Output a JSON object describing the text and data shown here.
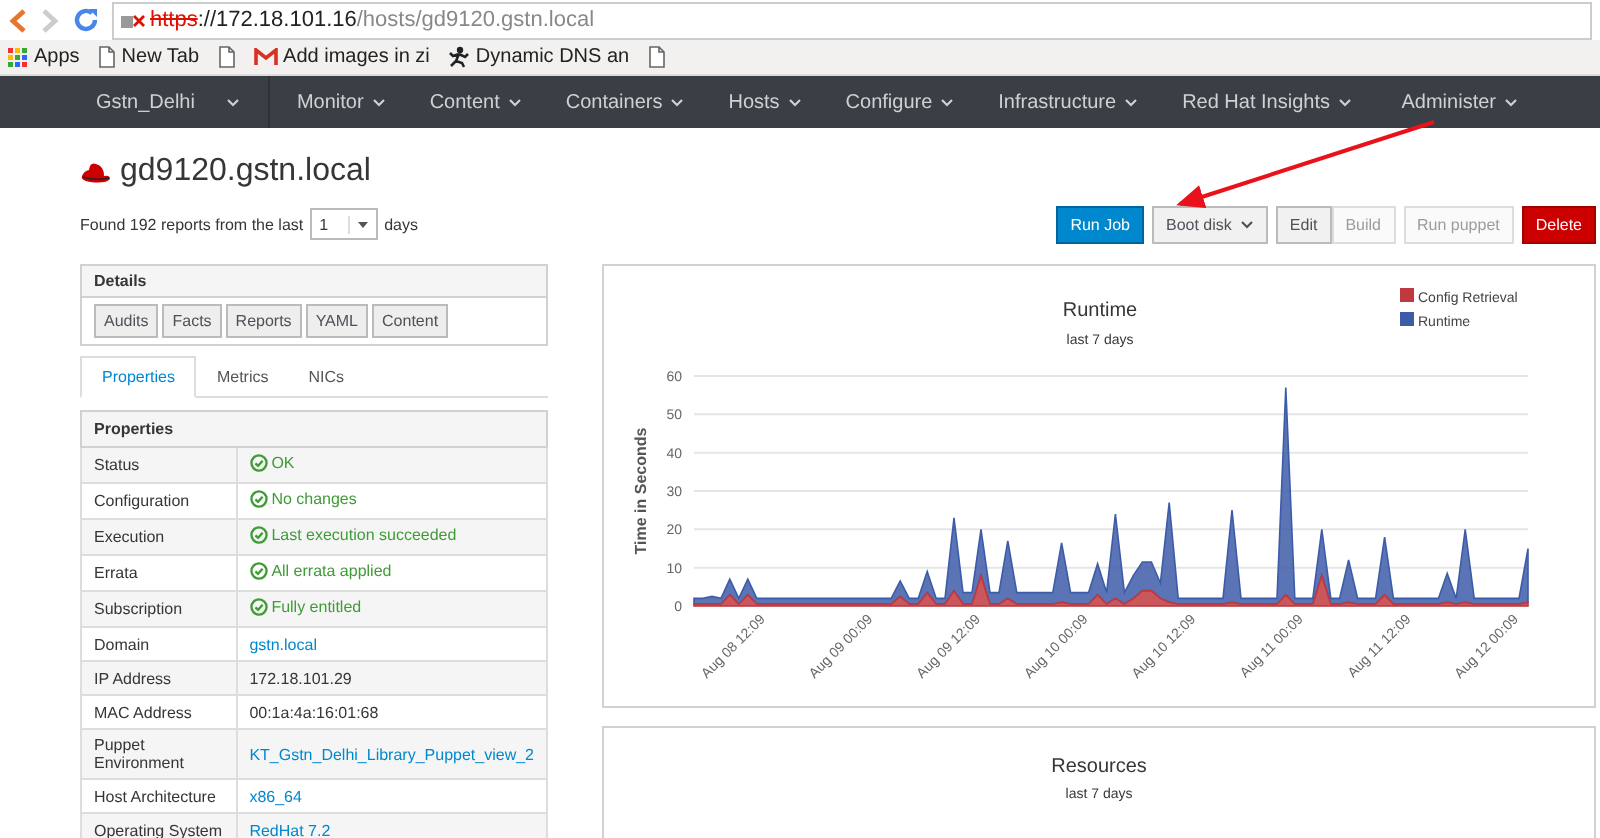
{
  "browser": {
    "url": {
      "scheme": "https",
      "host": "://172.18.101.16",
      "path": "/hosts/gd9120.gstn.local"
    },
    "bookmarks": [
      {
        "kind": "apps",
        "label": "Apps"
      },
      {
        "kind": "page",
        "label": "New Tab"
      },
      {
        "kind": "page"
      },
      {
        "kind": "mail",
        "label": "Add images in zi"
      },
      {
        "kind": "runner",
        "label": "Dynamic DNS an"
      },
      {
        "kind": "page"
      }
    ]
  },
  "nav": {
    "context": "Gstn_Delhi",
    "items": [
      {
        "label": "Monitor"
      },
      {
        "label": "Content"
      },
      {
        "label": "Containers"
      },
      {
        "label": "Hosts"
      },
      {
        "label": "Configure"
      },
      {
        "label": "Infrastructure"
      },
      {
        "label": "Red Hat Insights"
      }
    ],
    "user_menu": "Administer"
  },
  "host": {
    "title": "gd9120.gstn.local"
  },
  "reports": {
    "prefix": "Found 192 reports from the last",
    "days": "1",
    "suffix": "days"
  },
  "actions": [
    {
      "kind": "primary",
      "label": "Run Job",
      "disabled": false
    },
    {
      "kind": "dropdown",
      "label": "Boot disk",
      "disabled": false
    },
    {
      "kind": "group",
      "items": [
        {
          "label": "Edit",
          "disabled": false
        },
        {
          "label": "Build",
          "disabled": true
        }
      ]
    },
    {
      "kind": "default",
      "label": "Run puppet",
      "disabled": true
    },
    {
      "kind": "danger",
      "label": "Delete",
      "disabled": false
    }
  ],
  "details": {
    "title": "Details",
    "buttons": [
      "Audits",
      "Facts",
      "Reports",
      "YAML",
      "Content"
    ]
  },
  "tabs": [
    {
      "label": "Properties",
      "selected": true
    },
    {
      "label": "Metrics",
      "selected": false
    },
    {
      "label": "NICs",
      "selected": false
    }
  ],
  "properties": {
    "title": "Properties",
    "rows": [
      {
        "label": "Status",
        "value": "OK",
        "kind": "ok"
      },
      {
        "label": "Configuration",
        "value": "No changes",
        "kind": "ok"
      },
      {
        "label": "Execution",
        "value": "Last execution succeeded",
        "kind": "ok"
      },
      {
        "label": "Errata",
        "value": "All errata applied",
        "kind": "ok"
      },
      {
        "label": "Subscription",
        "value": "Fully entitled",
        "kind": "ok"
      },
      {
        "label": "Domain",
        "value": "gstn.local",
        "kind": "link"
      },
      {
        "label": "IP Address",
        "value": "172.18.101.29",
        "kind": "text"
      },
      {
        "label": "MAC Address",
        "value": "00:1a:4a:16:01:68",
        "kind": "text"
      },
      {
        "label": "Puppet Environment",
        "value": "KT_Gstn_Delhi_Library_Puppet_view_2",
        "kind": "link"
      },
      {
        "label": "Host Architecture",
        "value": "x86_64",
        "kind": "link"
      },
      {
        "label": "Operating System",
        "value": "RedHat 7.2",
        "kind": "link"
      }
    ]
  },
  "runtime_panel": {
    "subtitle": "last 7 days",
    "chart_data": {
      "type": "area",
      "title": "Runtime",
      "ylabel": "Time in Seconds",
      "stacked": true,
      "categories": [
        null,
        null,
        null,
        null,
        null,
        null,
        null,
        null,
        "Aug 08 12:09",
        null,
        null,
        null,
        null,
        null,
        null,
        null,
        null,
        null,
        null,
        null,
        "Aug 09 00:09",
        null,
        null,
        null,
        null,
        null,
        null,
        null,
        null,
        null,
        null,
        null,
        "Aug 09 12:09",
        null,
        null,
        null,
        null,
        null,
        null,
        null,
        null,
        null,
        null,
        null,
        "Aug 10 00:09",
        null,
        null,
        null,
        null,
        null,
        null,
        null,
        null,
        null,
        null,
        null,
        "Aug 10 12:09",
        null,
        null,
        null,
        null,
        null,
        null,
        null,
        null,
        null,
        null,
        null,
        "Aug 11 00:09",
        null,
        null,
        null,
        null,
        null,
        null,
        null,
        null,
        null,
        null,
        null,
        "Aug 11 12:09",
        null,
        null,
        null,
        null,
        null,
        null,
        null,
        null,
        null,
        null,
        null,
        "Aug 12 00:09",
        null
      ],
      "series": [
        {
          "name": "Config Retrieval",
          "color": "#c0393e",
          "values": [
            0.5,
            0.5,
            0.5,
            0.5,
            3,
            0.5,
            3,
            0.5,
            0.5,
            0.5,
            0.5,
            0.5,
            0.5,
            0.5,
            0.5,
            0.5,
            0.5,
            0.5,
            0.5,
            0.5,
            0.5,
            0.5,
            0.5,
            2.5,
            0.5,
            0.5,
            3.5,
            0.5,
            0.5,
            4,
            0.5,
            0.5,
            8,
            0.5,
            0.5,
            2,
            0.5,
            0.5,
            0.5,
            0.5,
            0.5,
            1,
            0.5,
            0.5,
            0.5,
            3,
            0.5,
            2,
            0.5,
            2,
            4,
            4,
            2,
            1,
            0.5,
            0.5,
            0.5,
            0.5,
            0.5,
            0.5,
            1,
            0.5,
            0.5,
            0.5,
            0.5,
            0.5,
            3,
            0.5,
            0.5,
            0.5,
            8,
            0.5,
            0.5,
            1,
            0.5,
            0.5,
            0.5,
            3,
            0.5,
            0.5,
            0.5,
            0.5,
            0.5,
            0.5,
            1,
            0.5,
            1,
            0.5,
            0.5,
            0.5,
            0.5,
            0.5,
            0.5,
            1
          ]
        },
        {
          "name": "Runtime",
          "color": "#3d5ca8",
          "values": [
            1.5,
            1.5,
            2,
            1.5,
            4,
            1.5,
            4,
            1.5,
            1.5,
            1.5,
            1.5,
            1.5,
            1.5,
            1.5,
            1.5,
            1.5,
            1.5,
            1.5,
            1.5,
            1.5,
            1.5,
            1.5,
            1.5,
            4,
            1.5,
            1.5,
            5.5,
            1.5,
            1.5,
            19,
            3,
            3,
            12,
            3,
            3,
            15,
            3,
            3,
            3,
            3,
            3,
            15.5,
            3,
            3,
            3,
            8,
            3,
            22,
            3,
            6,
            7.5,
            7.5,
            4,
            26,
            1.5,
            1.5,
            1.5,
            1.5,
            1.5,
            1.5,
            24,
            1.5,
            1.5,
            1.5,
            1.5,
            1.5,
            54,
            1.5,
            1.5,
            1.5,
            12,
            1.5,
            1.5,
            11,
            1.5,
            1.5,
            1.5,
            15,
            1.5,
            1.5,
            1.5,
            1.5,
            1.5,
            1.5,
            7.5,
            1.5,
            19,
            1.5,
            1.5,
            1.5,
            1.5,
            1.5,
            1.5,
            14
          ]
        }
      ],
      "ylim": [
        0,
        60
      ],
      "yticks": [
        0,
        10,
        20,
        30,
        40,
        50,
        60
      ],
      "grid": true,
      "legend": "top-right"
    }
  },
  "resources_panel": {
    "title": "Resources",
    "subtitle": "last 7 days"
  }
}
